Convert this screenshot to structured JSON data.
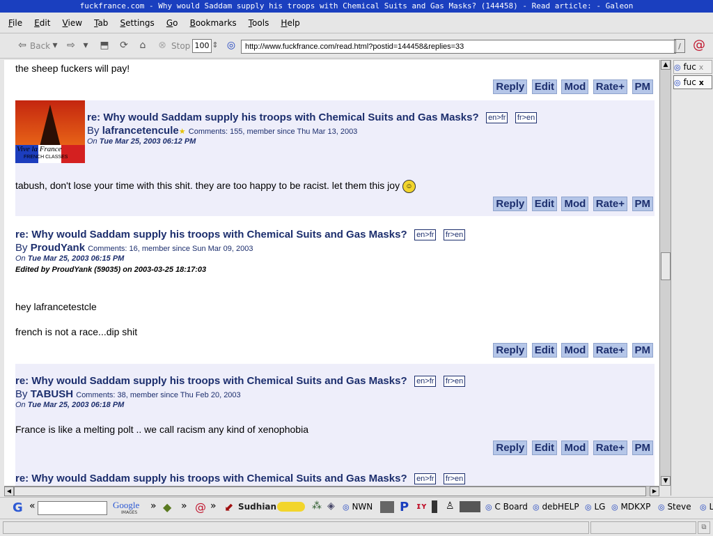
{
  "window": {
    "title": "fuckfrance.com - Why would Saddam supply his troops with Chemical Suits and Gas Masks? (144458) - Read article: - Galeon"
  },
  "menu": [
    "File",
    "Edit",
    "View",
    "Tab",
    "Settings",
    "Go",
    "Bookmarks",
    "Tools",
    "Help"
  ],
  "toolbar": {
    "back_label": "Back",
    "stop_label": "Stop",
    "zoom": "100",
    "url": "http://www.fuckfrance.com/read.html?postid=144458&replies=33"
  },
  "tabs": [
    "fuc",
    "fuc"
  ],
  "translate": {
    "en_fr": "en>fr",
    "fr_en": "fr>en"
  },
  "actions": {
    "reply": "Reply",
    "edit": "Edit",
    "mod": "Mod",
    "rate": "Rate+",
    "pm": "PM"
  },
  "posts": {
    "p0": {
      "body": "the sheep fuckers will pay!"
    },
    "p1": {
      "title": "re: Why would Saddam supply his troops with Chemical Suits and Gas Masks?",
      "by": "By",
      "author": "lafrancetencule",
      "meta": "Comments: 155, member since Thu Mar 13, 2003",
      "on": "On",
      "date": "Tue Mar 25, 2003 06:12 PM",
      "avatar_text1": "Vive la France",
      "avatar_text2": "FRENCH CLASSES",
      "body": "tabush, don't lose your time with this shit. they are too happy to be racist. let them this joy"
    },
    "p2": {
      "title": "re: Why would Saddam supply his troops with Chemical Suits and Gas Masks?",
      "by": "By",
      "author": "ProudYank",
      "meta": "Comments: 16, member since Sun Mar 09, 2003",
      "on": "On",
      "date": "Tue Mar 25, 2003 06:15 PM",
      "edited": "Edited by ProudYank (59035) on 2003-03-25 18:17:03",
      "body1": "hey lafrancetestcle",
      "body2": "french is not a race...dip shit"
    },
    "p3": {
      "title": "re: Why would Saddam supply his troops with Chemical Suits and Gas Masks?",
      "by": "By",
      "author": "TABUSH",
      "meta": "Comments: 38, member since Thu Feb 20, 2003",
      "on": "On",
      "date": "Tue Mar 25, 2003 06:18 PM",
      "body": "France is like a melting polt .. we call racism any kind of xenophobia"
    },
    "p4": {
      "title": "re: Why would Saddam supply his troops with Chemical Suits and Gas Masks?"
    }
  },
  "bottombar": {
    "google_label": "Google",
    "google_sub": "IMAGES",
    "sudhian": "Sudhian",
    "nwn": "NWN",
    "cboard": "C Board",
    "debhelp": "debHELP",
    "lg": "LG",
    "mdkxp": "MDKXP",
    "steve": "Steve",
    "l": "L"
  }
}
